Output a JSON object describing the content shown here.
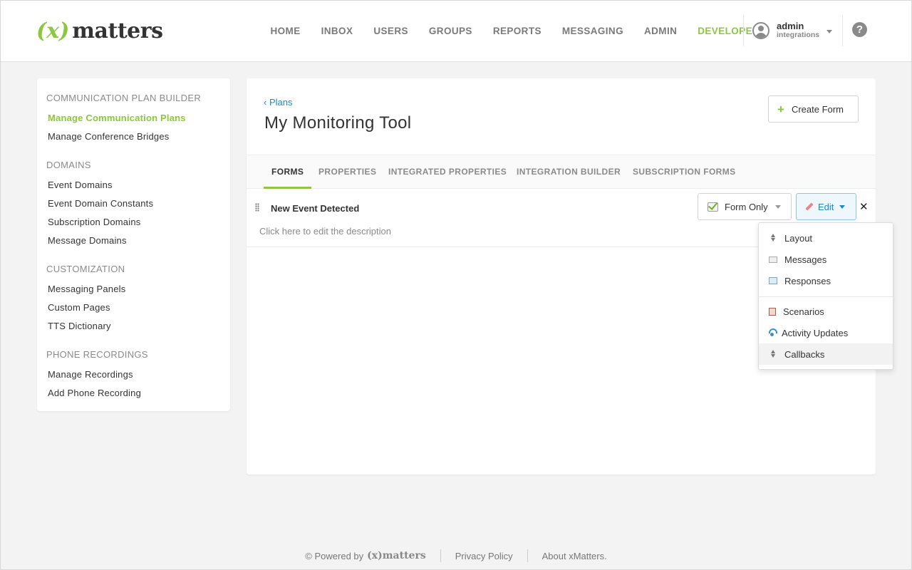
{
  "header": {
    "logo_x": "(x)",
    "logo_text": "matters",
    "nav": [
      "HOME",
      "INBOX",
      "USERS",
      "GROUPS",
      "REPORTS",
      "MESSAGING",
      "ADMIN",
      "DEVELOPER"
    ],
    "active_nav": "DEVELOPER",
    "user_name": "admin",
    "user_role": "integrations",
    "help": "?"
  },
  "sidebar": {
    "sections": [
      {
        "title": "COMMUNICATION PLAN BUILDER",
        "items": [
          "Manage Communication Plans",
          "Manage Conference Bridges"
        ]
      },
      {
        "title": "DOMAINS",
        "items": [
          "Event Domains",
          "Event Domain Constants",
          "Subscription Domains",
          "Message Domains"
        ]
      },
      {
        "title": "CUSTOMIZATION",
        "items": [
          "Messaging Panels",
          "Custom Pages",
          "TTS Dictionary"
        ]
      },
      {
        "title": "PHONE RECORDINGS",
        "items": [
          "Manage Recordings",
          "Add Phone Recording"
        ]
      }
    ],
    "active_item": "Manage Communication Plans"
  },
  "main": {
    "breadcrumb": "Plans",
    "title": "My Monitoring Tool",
    "create_button": "Create Form",
    "tabs": [
      "FORMS",
      "PROPERTIES",
      "INTEGRATED PROPERTIES",
      "INTEGRATION BUILDER",
      "SUBSCRIPTION FORMS"
    ],
    "active_tab": "FORMS",
    "form": {
      "name": "New Event Detected",
      "description_placeholder": "Click here to edit the description",
      "mode": "Form Only",
      "edit_label": "Edit"
    }
  },
  "edit_menu": {
    "group1": [
      "Layout",
      "Messages",
      "Responses"
    ],
    "group2": [
      "Scenarios",
      "Activity Updates",
      "Callbacks"
    ],
    "hovered": "Callbacks"
  },
  "footer": {
    "powered_by": "© Powered by",
    "logo": "(x)matters",
    "privacy": "Privacy Policy",
    "about": "About xMatters."
  },
  "colors": {
    "brand_green": "#8dc63f",
    "link_blue": "#1a8ac4"
  }
}
